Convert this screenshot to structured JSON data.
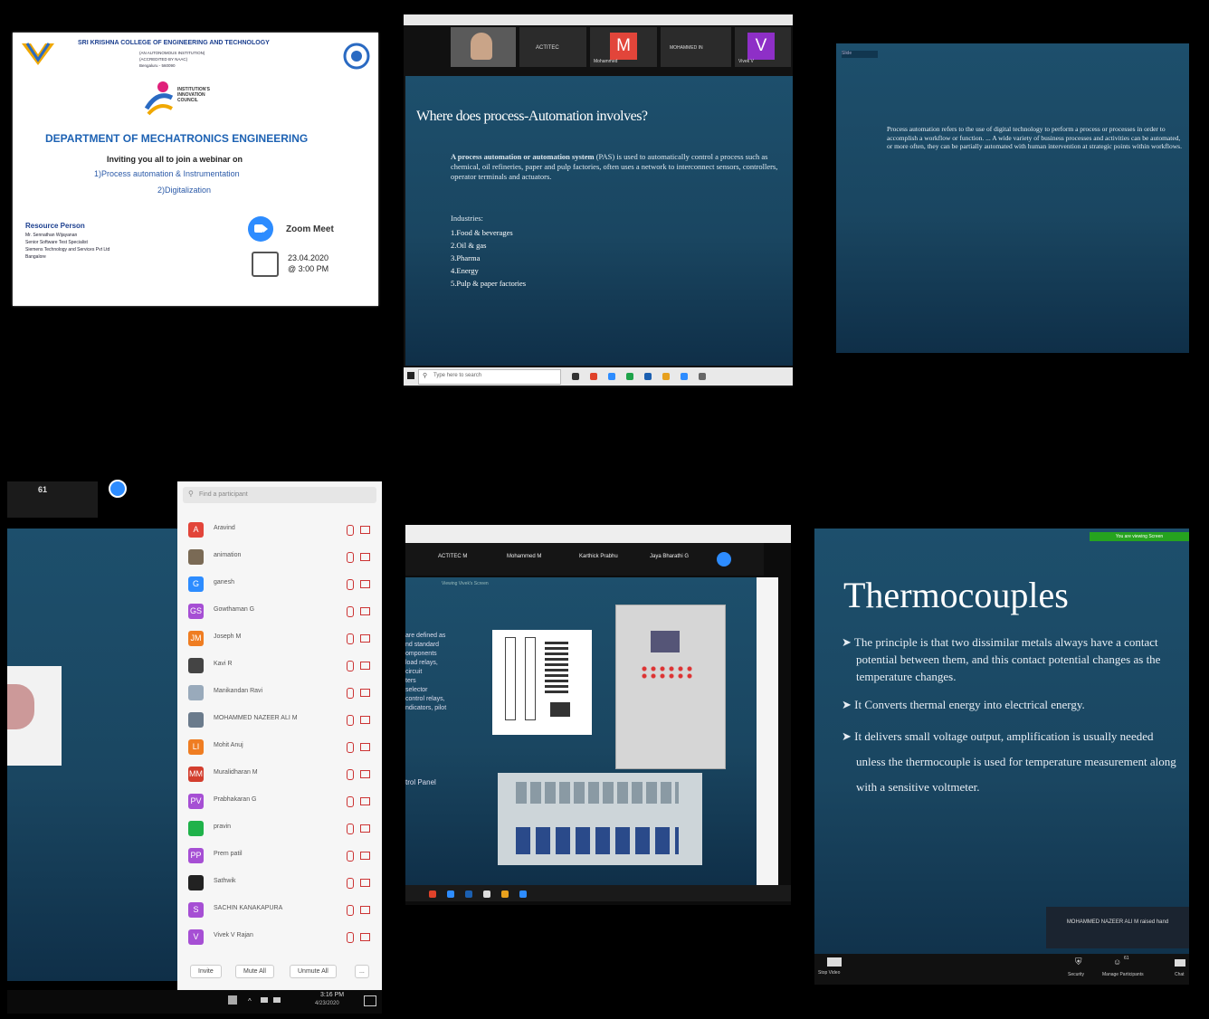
{
  "poster": {
    "college": "SRI KRISHNA COLLEGE OF ENGINEERING AND TECHNOLOGY",
    "college_sub1": "(AN AUTONOMOUS INSTITUTION)",
    "college_sub2": "(ACCREDITED BY NAAC)",
    "college_sub3": "Bengaluru - 560090",
    "council_line1": "INSTITUTION'S",
    "council_line2": "INNOVATION",
    "council_line3": "COUNCIL",
    "department": "DEPARTMENT OF MECHATRONICS ENGINEERING",
    "inviting": "Inviting you all to join a webinar on",
    "topic1": "1)Process automation & Instrumentation",
    "topic2": "2)Digitalization",
    "resource_heading": "Resource Person",
    "resource_name": "Mr. Sennathan Wijayanan",
    "resource_role": "Senior Software Test Specialist",
    "resource_org": "Siemens Technology and Services Pvt Ltd",
    "resource_city": "Bangalore",
    "platform": "Zoom Meet",
    "date": "23.04.2020",
    "time": "@ 3:00 PM"
  },
  "panel2": {
    "tiles": [
      {
        "name": "",
        "initial": ""
      },
      {
        "name": "ACTITEC",
        "initial": ""
      },
      {
        "name": "Mohammed",
        "initial": "M"
      },
      {
        "name": "MOHAMMED IN",
        "initial": ""
      },
      {
        "name": "Vivek V",
        "initial": "V"
      }
    ],
    "heading": "Where does process-Automation involves?",
    "para_bold": "A process automation or automation system",
    "para_rest": " (PAS) is used to automatically control a process such as chemical, oil refineries, paper and pulp factories, often uses a network to interconnect sensors, controllers, operator terminals and actuators.",
    "industries_label": "Industries:",
    "industries": [
      "1.Food & beverages",
      "2.Oil & gas",
      "3.Pharma",
      "4.Energy",
      "5.Pulp & paper factories"
    ],
    "search_placeholder": "Type here to search"
  },
  "panel3": {
    "tab_label": "Slide",
    "text_p1": "Process automation refers to the use of digital technology to perform a process or processes in order to accomplish a workflow or function. ... A wide variety of business processes and activities can be automated, or more often, they can be partially automated with human intervention at strategic points within workflows."
  },
  "panel4": {
    "count": "61",
    "search_placeholder": "Find a participant",
    "participants": [
      {
        "initial": "A",
        "name": "Aravind",
        "color": "#e2453a"
      },
      {
        "initial": "",
        "name": "animation",
        "color": "#7a6a55"
      },
      {
        "initial": "G",
        "name": "ganesh",
        "color": "#2d8cff"
      },
      {
        "initial": "GS",
        "name": "Gowthaman G",
        "color": "#a64fd4"
      },
      {
        "initial": "JM",
        "name": "Joseph M",
        "color": "#ef7d22"
      },
      {
        "initial": "",
        "name": "Kavi R",
        "color": "#444"
      },
      {
        "initial": "",
        "name": "Manikandan Ravi",
        "color": "#9ab"
      },
      {
        "initial": "",
        "name": "MOHAMMED NAZEER ALI M",
        "color": "#6b7b8c"
      },
      {
        "initial": "LI",
        "name": "Mohit Anuj",
        "color": "#ef7d22"
      },
      {
        "initial": "MM",
        "name": "Muralidharan M",
        "color": "#d33e2e"
      },
      {
        "initial": "PV",
        "name": "Prabhakaran G",
        "color": "#a64fd4"
      },
      {
        "initial": "",
        "name": "pravin",
        "color": "#1fb24a"
      },
      {
        "initial": "PP",
        "name": "Prem patil",
        "color": "#a64fd4"
      },
      {
        "initial": "",
        "name": "Sathwik",
        "color": "#222"
      },
      {
        "initial": "S",
        "name": "SACHIN KANAKAPURA",
        "color": "#a64fd4"
      },
      {
        "initial": "V",
        "name": "Vivek V Rajan",
        "color": "#a64fd4"
      }
    ],
    "buttons": {
      "invite": "Invite",
      "mute_all": "Mute All",
      "unmute_all": "Unmute All",
      "more": "..."
    },
    "clock_time": "3:16 PM",
    "clock_date": "4/23/2020"
  },
  "panel5": {
    "tabs": [
      "ACTITEC M",
      "Mohammed M",
      "Karthick Prabhu",
      "Jaya Bharathi G"
    ],
    "caption": "Viewing Vivek's Screen",
    "left_text": [
      "are defined as",
      "nd standard",
      "omponents",
      "load relays,",
      "circuit",
      "ters",
      "selector",
      "control relays,",
      "ndicators, pilot"
    ],
    "panel_label": "trol Panel"
  },
  "panel6": {
    "banner": "You are viewing Screen",
    "title": "Thermocouples",
    "bullets": [
      "The principle is that two dissimilar metals always have a contact potential between them, and this contact potential changes as the temperature changes.",
      "It Converts thermal energy into electrical energy.",
      "It delivers small voltage output, amplification is usually needed unless the thermocouple is used for temperature measurement along with a sensitive voltmeter."
    ],
    "toast": "MOHAMMED NAZEER ALI M raised hand",
    "controls": {
      "stop_video": "Stop Video",
      "security": "Security",
      "participants": "Manage Participants",
      "participant_count": "61",
      "chat": "Chat"
    }
  }
}
